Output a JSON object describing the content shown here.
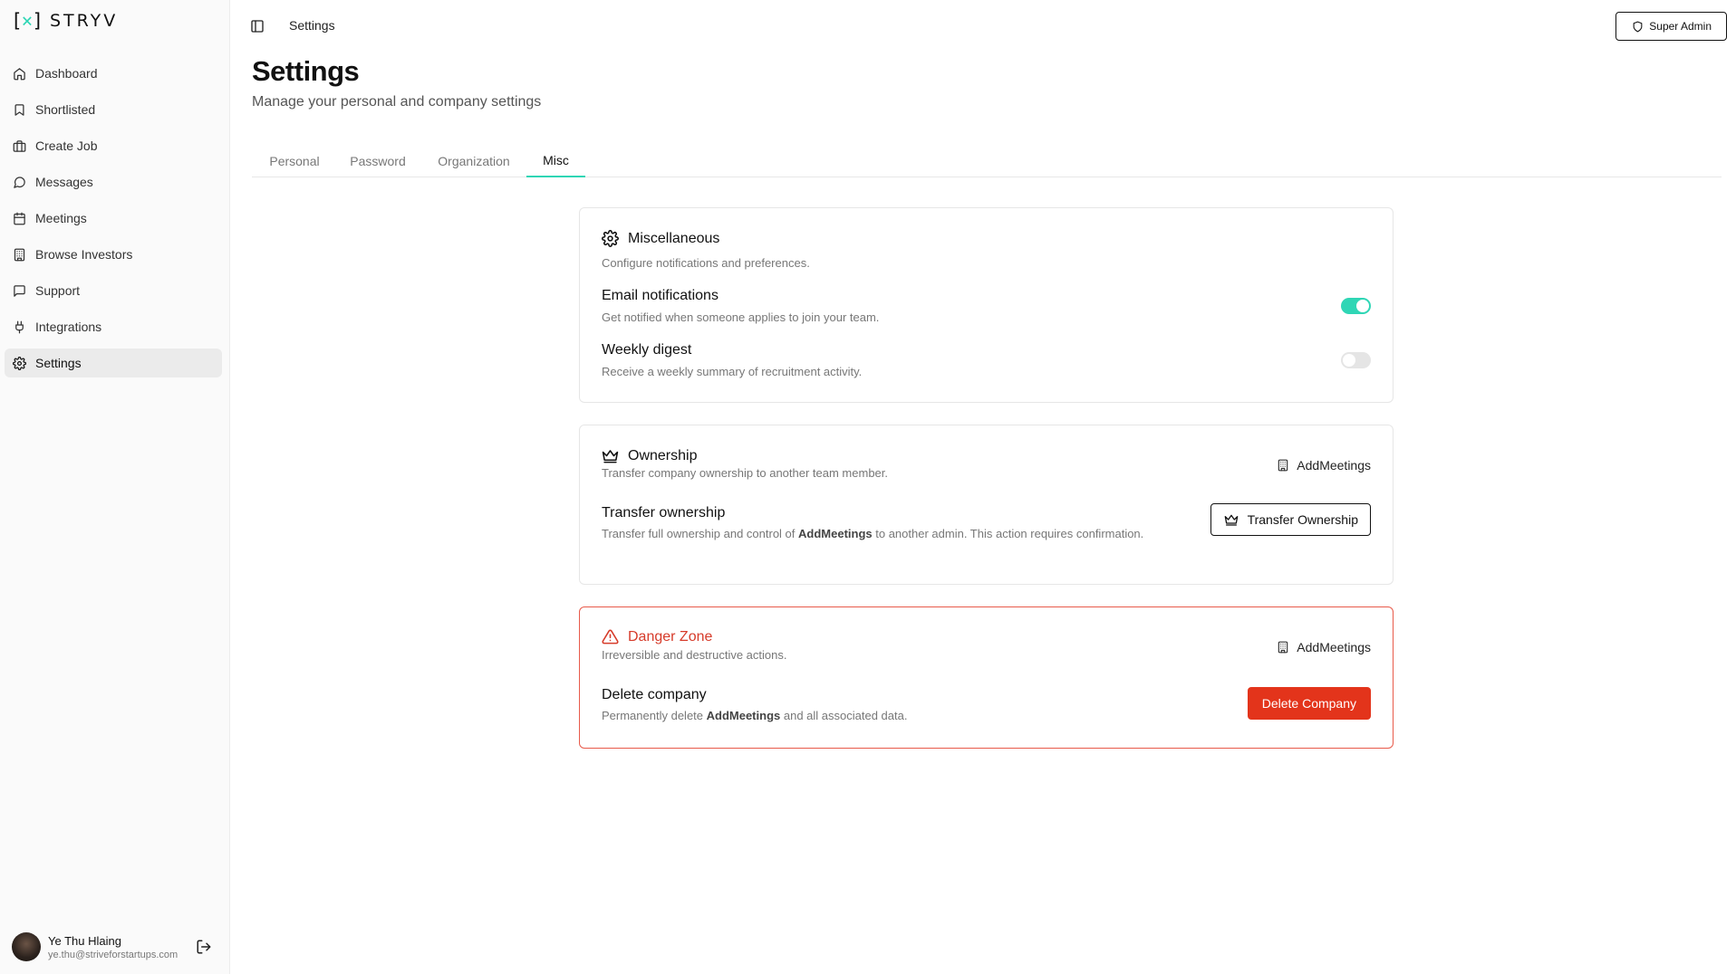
{
  "brand": {
    "mark_left": "[",
    "mark_x": "×",
    "mark_right": "]",
    "name": "STRYV"
  },
  "sidebar": {
    "items": [
      {
        "label": "Dashboard",
        "icon": "home-icon"
      },
      {
        "label": "Shortlisted",
        "icon": "bookmark-icon"
      },
      {
        "label": "Create Job",
        "icon": "briefcase-icon"
      },
      {
        "label": "Messages",
        "icon": "message-circle-icon"
      },
      {
        "label": "Meetings",
        "icon": "calendar-icon"
      },
      {
        "label": "Browse Investors",
        "icon": "building-icon"
      },
      {
        "label": "Support",
        "icon": "message-square-icon"
      },
      {
        "label": "Integrations",
        "icon": "plug-icon"
      },
      {
        "label": "Settings",
        "icon": "gear-icon",
        "active": true
      }
    ]
  },
  "user": {
    "name": "Ye Thu Hlaing",
    "email": "ye.thu@striveforstartups.com"
  },
  "header": {
    "breadcrumb": "Settings",
    "role_button": "Super Admin"
  },
  "page": {
    "title": "Settings",
    "subtitle": "Manage your personal and company settings"
  },
  "tabs": [
    {
      "label": "Personal"
    },
    {
      "label": "Password"
    },
    {
      "label": "Organization"
    },
    {
      "label": "Misc",
      "active": true
    }
  ],
  "misc": {
    "title": "Miscellaneous",
    "description": "Configure notifications and preferences.",
    "email_title": "Email notifications",
    "email_desc": "Get notified when someone applies to join your team.",
    "email_enabled": true,
    "digest_title": "Weekly digest",
    "digest_desc": "Receive a weekly summary of recruitment activity.",
    "digest_enabled": false
  },
  "ownership": {
    "title": "Ownership",
    "description": "Transfer company ownership to another team member.",
    "company": "AddMeetings",
    "row_title": "Transfer ownership",
    "row_desc_pre": "Transfer full ownership and control of ",
    "row_desc_company": "AddMeetings",
    "row_desc_post": " to another admin. This action requires confirmation.",
    "button": "Transfer Ownership"
  },
  "danger": {
    "title": "Danger Zone",
    "description": "Irreversible and destructive actions.",
    "company": "AddMeetings",
    "row_title": "Delete company",
    "row_desc_pre": "Permanently delete ",
    "row_desc_company": "AddMeetings",
    "row_desc_post": " and all associated data.",
    "button": "Delete Company",
    "accent": "#e3341b"
  },
  "colors": {
    "accent": "#2fd6b5",
    "danger": "#e3341b"
  }
}
